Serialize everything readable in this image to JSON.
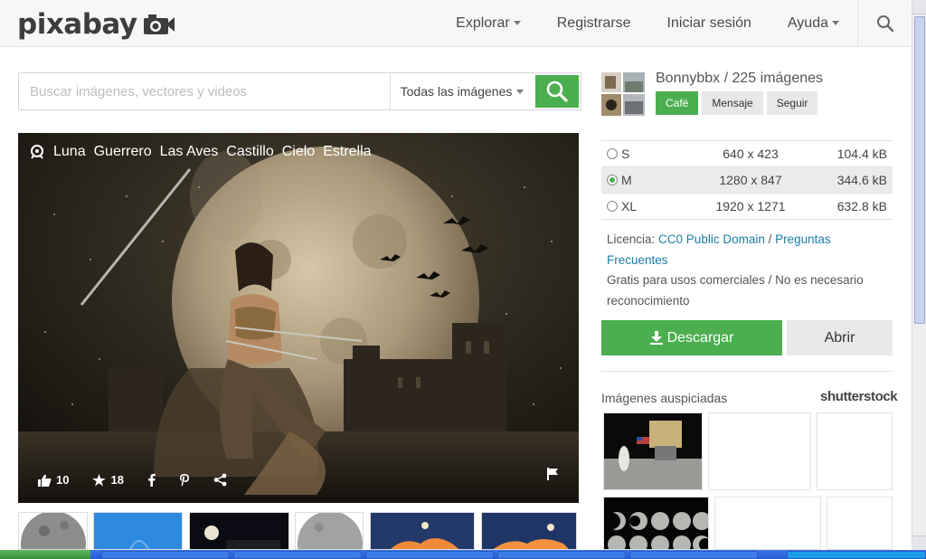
{
  "header": {
    "logo_text": "pixabay",
    "nav": [
      {
        "label": "Explorar",
        "dropdown": true
      },
      {
        "label": "Registrarse",
        "dropdown": false
      },
      {
        "label": "Iniciar sesión",
        "dropdown": false
      },
      {
        "label": "Ayuda",
        "dropdown": true
      }
    ],
    "search_icon": "search-icon"
  },
  "search": {
    "placeholder": "Buscar imágenes, vectores y videos",
    "value": "",
    "type_select": "Todas las imágenes",
    "button_icon": "search-icon"
  },
  "image": {
    "tags": [
      "Luna",
      "Guerrero",
      "Las Aves",
      "Castillo",
      "Cielo",
      "Estrella"
    ],
    "likes": "10",
    "favorites": "18",
    "actions": [
      "like-icon",
      "star-icon",
      "facebook-icon",
      "pinterest-icon",
      "share-icon",
      "flag-icon"
    ]
  },
  "user": {
    "name_line": "Bonnybbx / 225 imágenes",
    "buttons": {
      "cafe": "Café",
      "message": "Mensaje",
      "follow": "Seguir"
    }
  },
  "sizes": [
    {
      "label": "S",
      "dims": "640 x 423",
      "size": "104.4 kB",
      "selected": false
    },
    {
      "label": "M",
      "dims": "1280 x 847",
      "size": "344.6 kB",
      "selected": true
    },
    {
      "label": "XL",
      "dims": "1920 x 1271",
      "size": "632.8 kB",
      "selected": false
    }
  ],
  "license": {
    "prefix": "Licencia: ",
    "license_link": "CC0 Public Domain",
    "separator": " / ",
    "faq_link": "Preguntas Frecuentes",
    "note": "Gratis para usos comerciales / No es necesario reconocimiento"
  },
  "actions": {
    "download": "Descargar",
    "open": "Abrir"
  },
  "sponsored": {
    "label": "Imágenes auspiciadas",
    "provider": "shutterstock"
  },
  "colors": {
    "accent": "#4bae4f",
    "link": "#1b7da5"
  }
}
